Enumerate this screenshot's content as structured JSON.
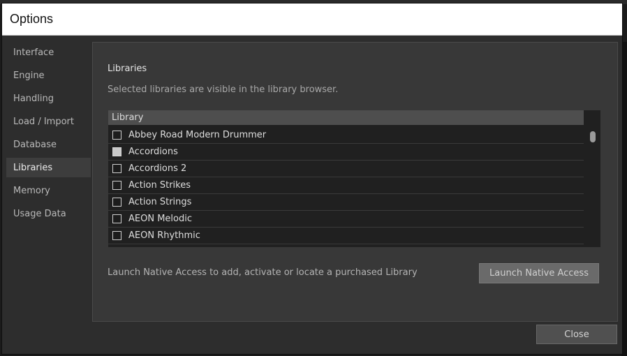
{
  "window": {
    "title": "Options"
  },
  "sidebar": {
    "items": [
      {
        "label": "Interface",
        "active": false
      },
      {
        "label": "Engine",
        "active": false
      },
      {
        "label": "Handling",
        "active": false
      },
      {
        "label": "Load / Import",
        "active": false
      },
      {
        "label": "Database",
        "active": false
      },
      {
        "label": "Libraries",
        "active": true
      },
      {
        "label": "Memory",
        "active": false
      },
      {
        "label": "Usage Data",
        "active": false
      }
    ]
  },
  "panel": {
    "title": "Libraries",
    "description": "Selected libraries are visible in the library browser.",
    "table": {
      "header": "Library",
      "rows": [
        {
          "name": "Abbey Road Modern Drummer",
          "checked": false
        },
        {
          "name": "Accordions",
          "checked": true
        },
        {
          "name": "Accordions 2",
          "checked": false
        },
        {
          "name": "Action Strikes",
          "checked": false
        },
        {
          "name": "Action Strings",
          "checked": false
        },
        {
          "name": "AEON Melodic",
          "checked": false
        },
        {
          "name": "AEON Rhythmic",
          "checked": false
        }
      ]
    },
    "launch_text": "Launch Native Access to add, activate or locate a purchased Library",
    "launch_button": "Launch Native Access"
  },
  "footer": {
    "close_button": "Close"
  },
  "colors": {
    "panel_bg": "#383838",
    "active_nav_bg": "#3d3d3d",
    "titlebar_bg": "#ffffff"
  }
}
